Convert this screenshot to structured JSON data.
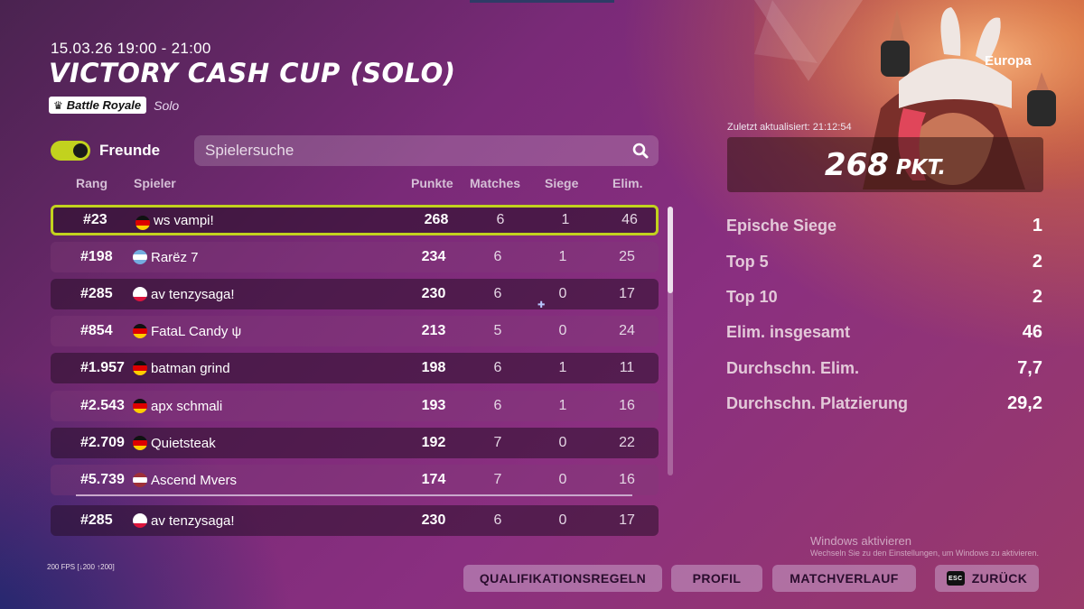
{
  "event": {
    "datetime": "15.03.26 19:00 - 21:00",
    "title": "VICTORY CASH CUP (SOLO)",
    "mode_badge": "Battle Royale",
    "mode_sub": "Solo",
    "mode_icon": "crown-icon"
  },
  "controls": {
    "friends_label": "Freunde",
    "friends_on": true,
    "search_placeholder": "Spielersuche",
    "accent": "#c2d21e"
  },
  "columns": {
    "rank": "Rang",
    "player": "Spieler",
    "points": "Punkte",
    "matches": "Matches",
    "wins": "Siege",
    "elims": "Elim."
  },
  "rows": [
    {
      "rank": "#23",
      "flag": "de",
      "name": "ws vampi!",
      "points": "268",
      "matches": "6",
      "wins": "1",
      "elims": "46"
    },
    {
      "rank": "#198",
      "flag": "ar",
      "name": "Rarëz 7",
      "points": "234",
      "matches": "6",
      "wins": "1",
      "elims": "25"
    },
    {
      "rank": "#285",
      "flag": "pl",
      "name": "av tenzysaga!",
      "points": "230",
      "matches": "6",
      "wins": "0",
      "elims": "17"
    },
    {
      "rank": "#854",
      "flag": "de",
      "name": "FataL Candy ψ",
      "points": "213",
      "matches": "5",
      "wins": "0",
      "elims": "24"
    },
    {
      "rank": "#1.957",
      "flag": "de",
      "name": "batman grind",
      "points": "198",
      "matches": "6",
      "wins": "1",
      "elims": "11"
    },
    {
      "rank": "#2.543",
      "flag": "de",
      "name": "apx schmali",
      "points": "193",
      "matches": "6",
      "wins": "1",
      "elims": "16"
    },
    {
      "rank": "#2.709",
      "flag": "de",
      "name": "Quietsteak",
      "points": "192",
      "matches": "7",
      "wins": "0",
      "elims": "22"
    },
    {
      "rank": "#5.739",
      "flag": "lv",
      "name": "Ascend Mvers",
      "points": "174",
      "matches": "7",
      "wins": "0",
      "elims": "16"
    }
  ],
  "pinned_row": {
    "rank": "#285",
    "flag": "pl",
    "name": "av tenzysaga!",
    "points": "230",
    "matches": "6",
    "wins": "0",
    "elims": "17"
  },
  "player_panel": {
    "region": "Europa",
    "updated": "Zuletzt aktualisiert: 21:12:54",
    "points": "268",
    "points_unit": "PKT.",
    "stats": [
      {
        "label": "Epische Siege",
        "value": "1"
      },
      {
        "label": "Top 5",
        "value": "2"
      },
      {
        "label": "Top 10",
        "value": "2"
      },
      {
        "label": "Elim. insgesamt",
        "value": "46"
      },
      {
        "label": "Durchschn. Elim.",
        "value": "7,7"
      },
      {
        "label": "Durchschn. Platzierung",
        "value": "29,2"
      }
    ]
  },
  "windows": {
    "activate_title": "Windows aktivieren",
    "activate_sub": "Wechseln Sie zu den Einstellungen, um Windows zu aktivieren."
  },
  "fps": "200 FPS [↓200 ↑200]",
  "buttons": {
    "rules": "QUALIFIKATIONSREGELN",
    "profile": "PROFIL",
    "history": "MATCHVERLAUF",
    "back": "ZURÜCK",
    "back_key": "ESC"
  },
  "flags": {
    "de": [
      "#111111",
      "#dd0000",
      "#ffce00"
    ],
    "ar": [
      "#74acdf",
      "#ffffff",
      "#74acdf"
    ],
    "pl": [
      "#ffffff",
      "#ffffff",
      "#dc143c"
    ],
    "lv": [
      "#9e3039",
      "#ffffff",
      "#9e3039"
    ]
  }
}
